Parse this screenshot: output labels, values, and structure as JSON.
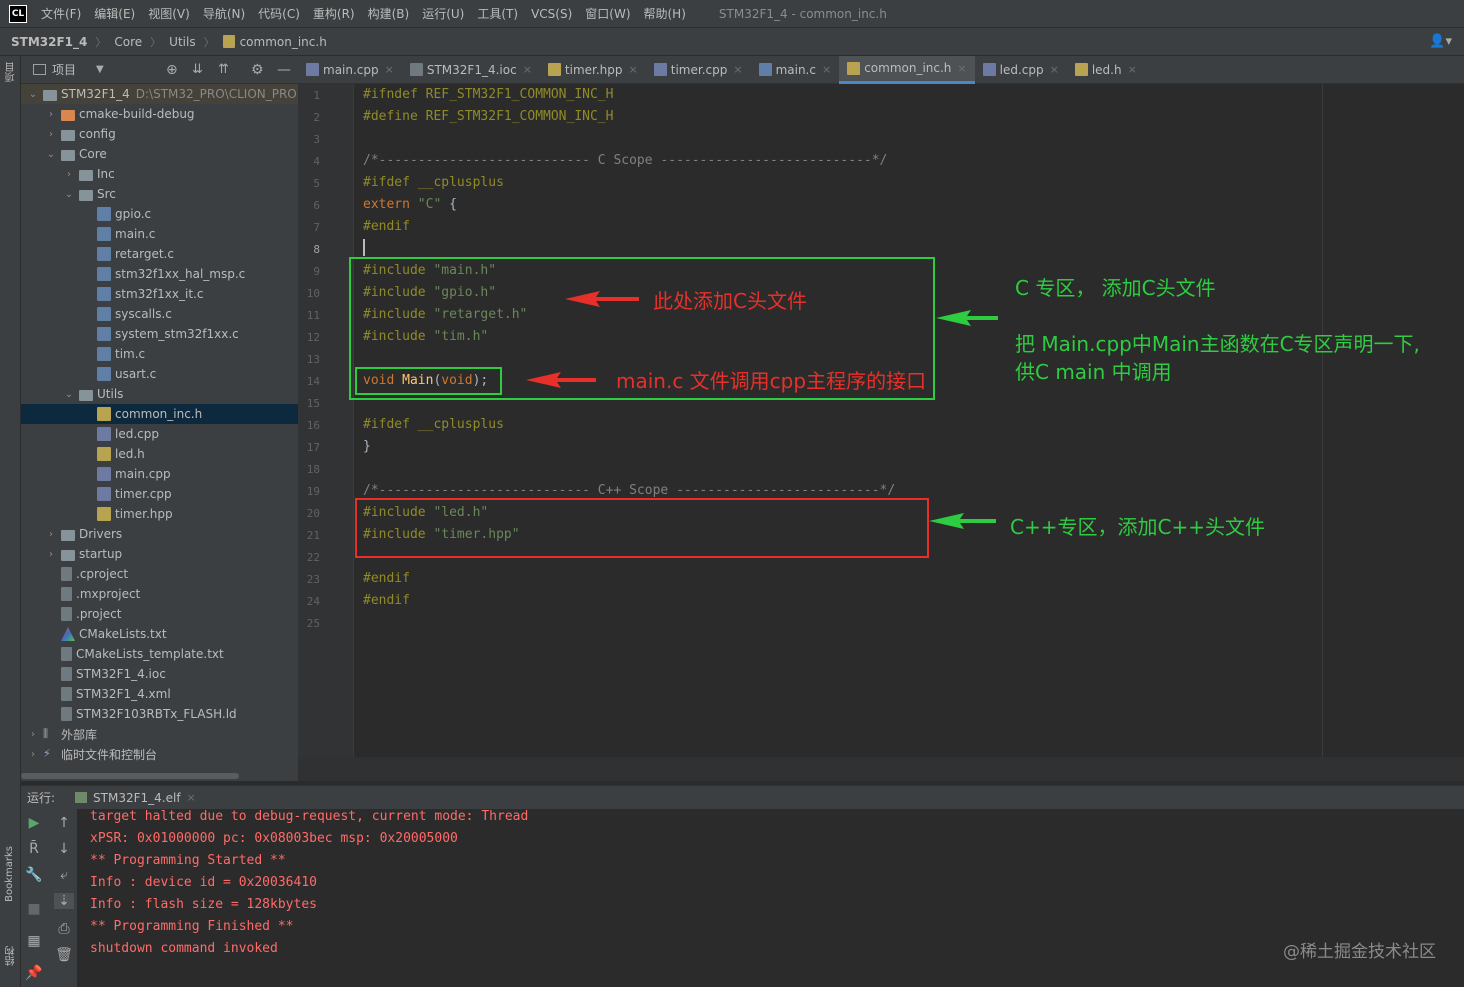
{
  "menubar": {
    "logo": "CL",
    "items": [
      "文件(F)",
      "编辑(E)",
      "视图(V)",
      "导航(N)",
      "代码(C)",
      "重构(R)",
      "构建(B)",
      "运行(U)",
      "工具(T)",
      "VCS(S)",
      "窗口(W)",
      "帮助(H)"
    ],
    "window_title": "STM32F1_4 - common_inc.h"
  },
  "navbar": {
    "crumbs": [
      "STM32F1_4",
      "Core",
      "Utils",
      "common_inc.h"
    ]
  },
  "left_strip": {
    "project_label": "项目",
    "bookmarks_label": "Bookmarks",
    "structure_label": "结构"
  },
  "project_panel": {
    "title": "项目",
    "tree": [
      {
        "label": "STM32F1_4",
        "hint": "D:\\STM32_PRO\\CLION_PRO",
        "icon": "folder",
        "depth": 0,
        "expanded": true
      },
      {
        "label": "cmake-build-debug",
        "icon": "folder-orange",
        "depth": 1,
        "expanded": false
      },
      {
        "label": "config",
        "icon": "folder",
        "depth": 1,
        "expanded": false
      },
      {
        "label": "Core",
        "icon": "folder",
        "depth": 1,
        "expanded": true
      },
      {
        "label": "Inc",
        "icon": "folder",
        "depth": 2,
        "expanded": false
      },
      {
        "label": "Src",
        "icon": "folder",
        "depth": 2,
        "expanded": true
      },
      {
        "label": "gpio.c",
        "icon": "c",
        "depth": 3
      },
      {
        "label": "main.c",
        "icon": "c",
        "depth": 3
      },
      {
        "label": "retarget.c",
        "icon": "c",
        "depth": 3
      },
      {
        "label": "stm32f1xx_hal_msp.c",
        "icon": "c",
        "depth": 3
      },
      {
        "label": "stm32f1xx_it.c",
        "icon": "c",
        "depth": 3
      },
      {
        "label": "syscalls.c",
        "icon": "c",
        "depth": 3
      },
      {
        "label": "system_stm32f1xx.c",
        "icon": "c",
        "depth": 3
      },
      {
        "label": "tim.c",
        "icon": "c",
        "depth": 3
      },
      {
        "label": "usart.c",
        "icon": "c",
        "depth": 3
      },
      {
        "label": "Utils",
        "icon": "folder",
        "depth": 2,
        "expanded": true
      },
      {
        "label": "common_inc.h",
        "icon": "h",
        "depth": 3,
        "selected": true
      },
      {
        "label": "led.cpp",
        "icon": "cpp",
        "depth": 3
      },
      {
        "label": "led.h",
        "icon": "h",
        "depth": 3
      },
      {
        "label": "main.cpp",
        "icon": "cpp",
        "depth": 3
      },
      {
        "label": "timer.cpp",
        "icon": "cpp",
        "depth": 3
      },
      {
        "label": "timer.hpp",
        "icon": "h",
        "depth": 3
      },
      {
        "label": "Drivers",
        "icon": "folder",
        "depth": 1,
        "expanded": false
      },
      {
        "label": "startup",
        "icon": "folder",
        "depth": 1,
        "expanded": false
      },
      {
        "label": ".cproject",
        "icon": "gen",
        "depth": 1
      },
      {
        "label": ".mxproject",
        "icon": "gen",
        "depth": 1
      },
      {
        "label": ".project",
        "icon": "gen",
        "depth": 1
      },
      {
        "label": "CMakeLists.txt",
        "icon": "cmake",
        "depth": 1
      },
      {
        "label": "CMakeLists_template.txt",
        "icon": "gen",
        "depth": 1
      },
      {
        "label": "STM32F1_4.ioc",
        "icon": "gen",
        "depth": 1
      },
      {
        "label": "STM32F1_4.xml",
        "icon": "gen",
        "depth": 1
      },
      {
        "label": "STM32F103RBTx_FLASH.ld",
        "icon": "gen",
        "depth": 1
      },
      {
        "label": "外部库",
        "icon": "lib",
        "depth": 0,
        "expanded": false
      },
      {
        "label": "临时文件和控制台",
        "icon": "scratch",
        "depth": 0,
        "expanded": false
      }
    ]
  },
  "editor_tabs": [
    {
      "label": "main.cpp",
      "icon": "cpp"
    },
    {
      "label": "STM32F1_4.ioc",
      "icon": "gen"
    },
    {
      "label": "timer.hpp",
      "icon": "h"
    },
    {
      "label": "timer.cpp",
      "icon": "cpp"
    },
    {
      "label": "main.c",
      "icon": "c"
    },
    {
      "label": "common_inc.h",
      "icon": "h",
      "active": true
    },
    {
      "label": "led.cpp",
      "icon": "cpp"
    },
    {
      "label": "led.h",
      "icon": "h"
    }
  ],
  "editor": {
    "current_line": 8,
    "lines": [
      [
        [
          "mac",
          "#ifndef "
        ],
        [
          "mac",
          "REF_STM32F1_COMMON_INC_H"
        ]
      ],
      [
        [
          "mac",
          "#define "
        ],
        [
          "mac",
          "REF_STM32F1_COMMON_INC_H"
        ]
      ],
      [],
      [
        [
          "cmt",
          "/*--------------------------- C Scope ---------------------------*/"
        ]
      ],
      [
        [
          "mac",
          "#ifdef "
        ],
        [
          "mac",
          "__cplusplus"
        ]
      ],
      [
        [
          "kw",
          "extern "
        ],
        [
          "str",
          "\"C\""
        ],
        [
          "txt",
          " {"
        ]
      ],
      [
        [
          "mac",
          "#endif"
        ]
      ],
      [],
      [
        [
          "mac",
          "#include "
        ],
        [
          "str",
          "\"main.h\""
        ]
      ],
      [
        [
          "mac",
          "#include "
        ],
        [
          "str",
          "\"gpio.h\""
        ]
      ],
      [
        [
          "mac",
          "#include "
        ],
        [
          "str",
          "\"retarget.h\""
        ]
      ],
      [
        [
          "mac",
          "#include "
        ],
        [
          "str",
          "\"tim.h\""
        ]
      ],
      [],
      [
        [
          "kw",
          "void "
        ],
        [
          "fn",
          "Main"
        ],
        [
          "txt",
          "("
        ],
        [
          "kw",
          "void"
        ],
        [
          "txt",
          ");"
        ]
      ],
      [],
      [
        [
          "mac",
          "#ifdef "
        ],
        [
          "mac",
          "__cplusplus"
        ]
      ],
      [
        [
          "txt",
          "}"
        ]
      ],
      [],
      [
        [
          "cmt",
          "/*--------------------------- C++ Scope --------------------------*/"
        ]
      ],
      [
        [
          "mac",
          "#include "
        ],
        [
          "str",
          "\"led.h\""
        ]
      ],
      [
        [
          "mac",
          "#include "
        ],
        [
          "str",
          "\"timer.hpp\""
        ]
      ],
      [],
      [
        [
          "mac",
          "#endif"
        ]
      ],
      [
        [
          "mac",
          "#endif"
        ]
      ],
      []
    ]
  },
  "annotations": {
    "c_include_note": "此处添加C头文件",
    "main_note": "main.c 文件调用cpp主程序的接口",
    "c_zone_title": "C 专区， 添加C头文件",
    "c_zone_desc_1": "把 Main.cpp中Main主函数在C专区声明一下,",
    "c_zone_desc_2": "供C main 中调用",
    "cpp_zone": "C++专区，添加C++头文件",
    "green": "#2ecc40",
    "red": "#e8302b"
  },
  "run_panel": {
    "label": "运行:",
    "config": "STM32F1_4.elf",
    "console": [
      "target halted due to debug-request, current mode: Thread",
      "xPSR: 0x01000000 pc: 0x08003bec msp: 0x20005000",
      "** Programming Started **",
      "Info : device id = 0x20036410",
      "Info : flash size = 128kbytes",
      "** Programming Finished **",
      "shutdown command invoked"
    ]
  },
  "watermark": "@稀土掘金技术社区"
}
